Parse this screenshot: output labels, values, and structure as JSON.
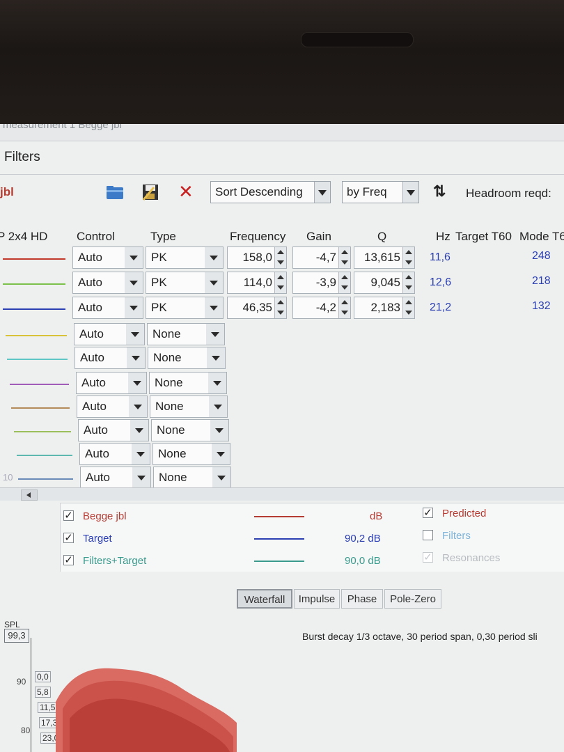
{
  "window": {
    "title_partial": "measurement 1 Begge jbl",
    "name": "Filters"
  },
  "toolbar": {
    "measurement_label": "jbl",
    "sort_order": "Sort Descending",
    "sort_by": "by Freq",
    "headroom_label": "Headroom reqd:",
    "icons": [
      "folder-icon",
      "save-icon",
      "delete-icon",
      "sort-icon"
    ]
  },
  "columns": {
    "eq": "P 2x4 HD",
    "control": "Control",
    "type": "Type",
    "frequency": "Frequency",
    "gain": "Gain",
    "q": "Q",
    "hz": "Hz",
    "target_t60": "Target T60",
    "mode_t6": "Mode T6"
  },
  "filters": [
    {
      "control": "Auto",
      "type": "PK",
      "frequency": "158,0",
      "gain": "-4,7",
      "q": "13,615",
      "hz": "11,6",
      "mode": "248",
      "color": "#c0392b"
    },
    {
      "control": "Auto",
      "type": "PK",
      "frequency": "114,0",
      "gain": "-3,9",
      "q": "9,045",
      "hz": "12,6",
      "mode": "218",
      "color": "#7ac04a"
    },
    {
      "control": "Auto",
      "type": "PK",
      "frequency": "46,35",
      "gain": "-4,2",
      "q": "2,183",
      "hz": "21,2",
      "mode": "132",
      "color": "#2b3fb2"
    },
    {
      "control": "Auto",
      "type": "None",
      "color": "#d8c23a"
    },
    {
      "control": "Auto",
      "type": "None",
      "color": "#5fc6c6"
    },
    {
      "control": "Auto",
      "type": "None",
      "color": "#a05cb8"
    },
    {
      "control": "Auto",
      "type": "None",
      "color": "#b38a5a"
    },
    {
      "control": "Auto",
      "type": "None",
      "color": "#9bbf5a"
    },
    {
      "control": "Auto",
      "type": "None",
      "color": "#5fb8b0"
    },
    {
      "control": "Auto",
      "type": "None",
      "num": "10",
      "color": "#6a8ab8"
    }
  ],
  "legend": [
    {
      "label": "Begge jbl",
      "checked": true,
      "value": "dB",
      "color": "#b53c33"
    },
    {
      "label": "Target",
      "checked": true,
      "value": "90,2 dB",
      "color": "#2b3fb2"
    },
    {
      "label": "Filters+Target",
      "checked": true,
      "value": "90,0 dB",
      "color": "#3a9a8c"
    }
  ],
  "options": [
    {
      "label": "Predicted",
      "checked": true,
      "color": "#b53c33"
    },
    {
      "label": "Filters",
      "checked": false,
      "color": "#7fb4d8"
    },
    {
      "label": "Resonances",
      "checked": true,
      "color": "#b8bcc0"
    }
  ],
  "tabs": [
    "Waterfall",
    "Impulse",
    "Phase",
    "Pole-Zero"
  ],
  "active_tab": "Waterfall",
  "waterfall": {
    "spl_label": "SPL",
    "spl_value": "99,3",
    "description": "Burst decay 1/3 octave, 30 period span, 0,30 period sli",
    "y_ticks": [
      "90",
      "80"
    ],
    "time_ticks": [
      "0,0",
      "5,8",
      "11,5",
      "17,3",
      "23,0"
    ]
  }
}
